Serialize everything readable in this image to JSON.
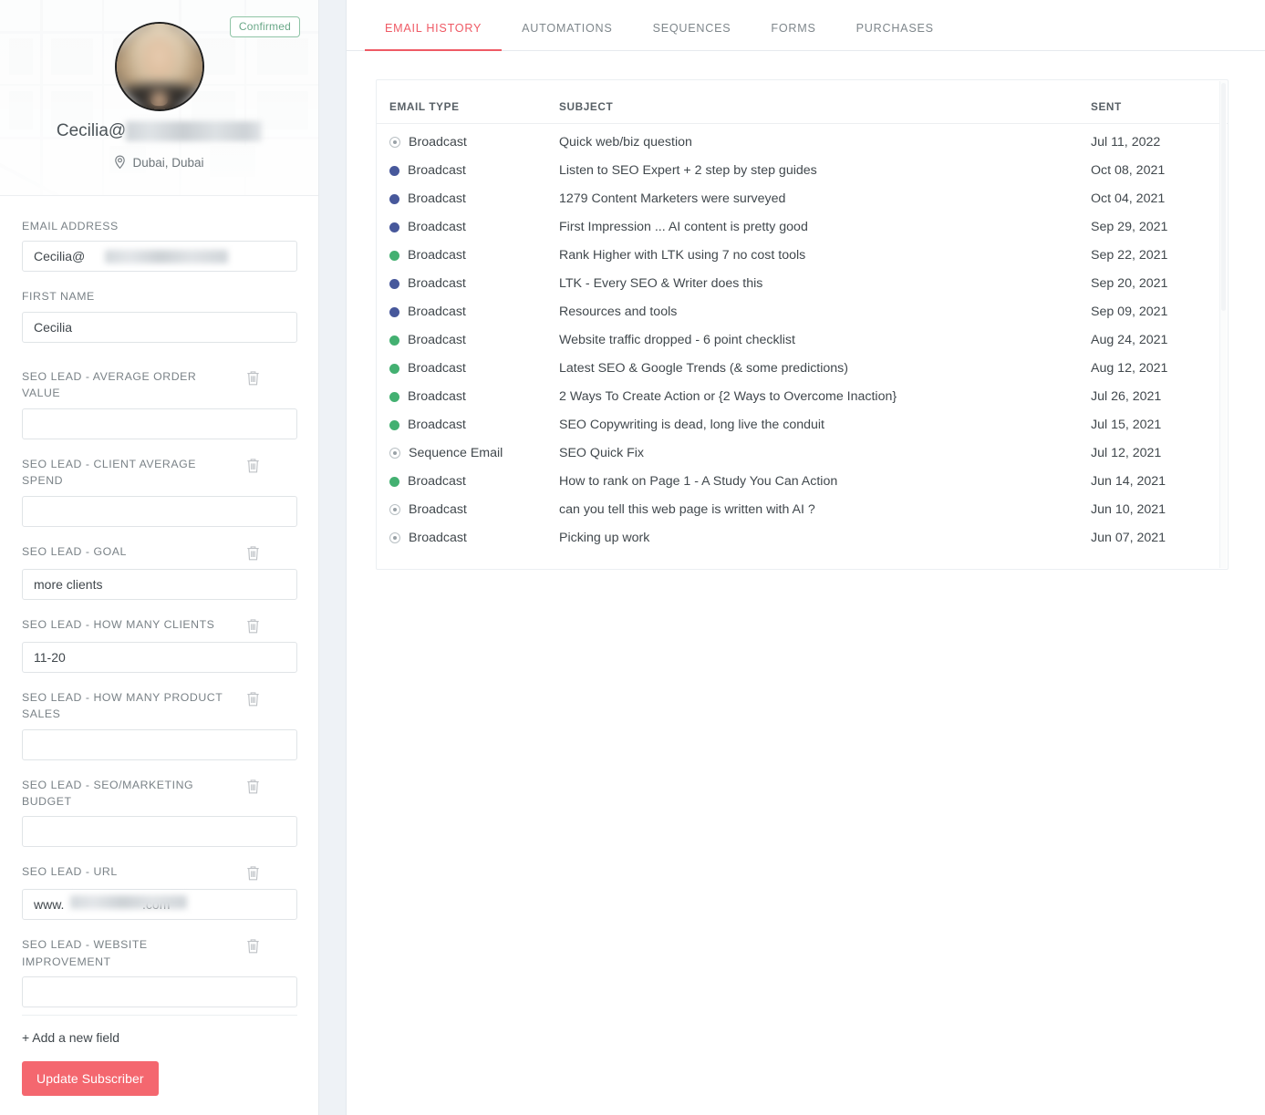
{
  "profile": {
    "badge": "Confirmed",
    "email_display_prefix": "Cecilia@",
    "email_display_redacted": "ceciliaclason.com",
    "location": "Dubai, Dubai",
    "location_icon": "map-pin-icon",
    "avatar_icon": "avatar"
  },
  "form": {
    "fields": [
      {
        "label": "EMAIL ADDRESS",
        "value": "Cecilia@",
        "redacted_suffix": "ceciliaclason.com",
        "deletable": false,
        "redacted": true
      },
      {
        "label": "FIRST NAME",
        "value": "Cecilia",
        "deletable": false,
        "redacted": false
      },
      {
        "label": "SEO LEAD - AVERAGE ORDER VALUE",
        "value": "",
        "deletable": true,
        "redacted": false
      },
      {
        "label": "SEO LEAD - CLIENT AVERAGE SPEND",
        "value": "",
        "deletable": true,
        "redacted": false
      },
      {
        "label": "SEO LEAD - GOAL",
        "value": "more clients",
        "deletable": true,
        "redacted": false
      },
      {
        "label": "SEO LEAD - HOW MANY CLIENTS",
        "value": "11-20",
        "deletable": true,
        "redacted": false
      },
      {
        "label": "SEO LEAD - HOW MANY PRODUCT SALES",
        "value": "",
        "deletable": true,
        "redacted": false
      },
      {
        "label": "SEO LEAD - SEO/MARKETING BUDGET",
        "value": "",
        "deletable": true,
        "redacted": false
      },
      {
        "label": "SEO LEAD - URL",
        "value": "www.",
        "redacted_suffix": "ceciliaclasoninteriors",
        "value_tail": ".com",
        "deletable": true,
        "redacted": true
      },
      {
        "label": "SEO LEAD - WEBSITE IMPROVEMENT",
        "value": "",
        "deletable": true,
        "redacted": false
      }
    ],
    "add_field_label": "+ Add a new field",
    "update_button": "Update Subscriber",
    "delete_icon": "trash-icon"
  },
  "tabs": [
    {
      "label": "EMAIL HISTORY",
      "active": true
    },
    {
      "label": "AUTOMATIONS",
      "active": false
    },
    {
      "label": "SEQUENCES",
      "active": false
    },
    {
      "label": "FORMS",
      "active": false
    },
    {
      "label": "PURCHASES",
      "active": false
    }
  ],
  "table": {
    "columns": [
      "EMAIL TYPE",
      "SUBJECT",
      "SENT"
    ],
    "rows": [
      {
        "status": "ring",
        "type": "Broadcast",
        "subject": "Quick web/biz question",
        "sent": "Jul 11, 2022"
      },
      {
        "status": "blue",
        "type": "Broadcast",
        "subject": "Listen to SEO Expert + 2 step by step guides",
        "sent": "Oct 08, 2021"
      },
      {
        "status": "blue",
        "type": "Broadcast",
        "subject": "1279 Content Marketers were surveyed",
        "sent": "Oct 04, 2021"
      },
      {
        "status": "blue",
        "type": "Broadcast",
        "subject": "First Impression ... AI content is pretty good",
        "sent": "Sep 29, 2021"
      },
      {
        "status": "green",
        "type": "Broadcast",
        "subject": "Rank Higher with LTK using 7 no cost tools",
        "sent": "Sep 22, 2021"
      },
      {
        "status": "blue",
        "type": "Broadcast",
        "subject": "LTK - Every SEO & Writer does this",
        "sent": "Sep 20, 2021"
      },
      {
        "status": "blue",
        "type": "Broadcast",
        "subject": "Resources and tools",
        "sent": "Sep 09, 2021"
      },
      {
        "status": "green",
        "type": "Broadcast",
        "subject": "Website traffic dropped - 6 point checklist",
        "sent": "Aug 24, 2021"
      },
      {
        "status": "green",
        "type": "Broadcast",
        "subject": "Latest SEO & Google Trends (& some predictions)",
        "sent": "Aug 12, 2021"
      },
      {
        "status": "green",
        "type": "Broadcast",
        "subject": "2 Ways To Create Action or {2 Ways to Overcome Inaction}",
        "sent": "Jul 26, 2021"
      },
      {
        "status": "green",
        "type": "Broadcast",
        "subject": "SEO Copywriting is dead, long live the conduit",
        "sent": "Jul 15, 2021"
      },
      {
        "status": "ring",
        "type": "Sequence Email",
        "subject": "SEO Quick Fix",
        "sent": "Jul 12, 2021"
      },
      {
        "status": "green",
        "type": "Broadcast",
        "subject": "How to rank on Page 1 - A Study You Can Action",
        "sent": "Jun 14, 2021"
      },
      {
        "status": "ring",
        "type": "Broadcast",
        "subject": "can you tell this web page is written with AI ?",
        "sent": "Jun 10, 2021"
      },
      {
        "status": "ring",
        "type": "Broadcast",
        "subject": "Picking up work",
        "sent": "Jun 07, 2021"
      }
    ]
  },
  "colors": {
    "accent": "#ef5a65",
    "button": "#f4676f",
    "confirmed": "#6aa888",
    "status_blue": "#47589b",
    "status_green": "#43b071",
    "status_ring": "#b9c0c4"
  }
}
